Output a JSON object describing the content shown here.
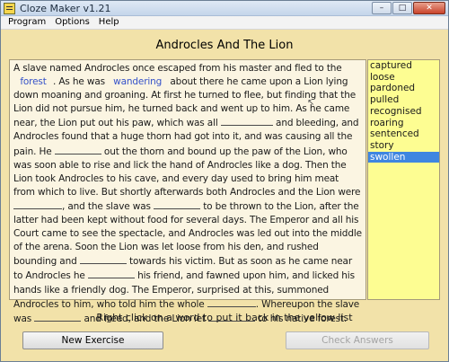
{
  "window": {
    "title": "Cloze Maker v1.21",
    "controls": {
      "minimize": "–",
      "maximize": "□",
      "close": "✕"
    }
  },
  "menu": [
    "Program",
    "Options",
    "Help"
  ],
  "story_title": "Androcles And The Lion",
  "story": {
    "p1": "A slave named Androcles once escaped from his master and fled to the",
    "blank1": "forest",
    "p2": ". As he was",
    "blank2": "wandering",
    "p3": "about there he came upon a Lion lying down moaning and groaning. At first he turned to flee, but finding that the Lion did not pursue him, he turned back and went up to him. As he came near, the Lion put out his paw, which was all",
    "p4": "and bleeding, and Androcles found that a huge thorn had got into it, and was causing all the pain. He",
    "p5": "out the thorn and bound up the paw of the Lion, who was soon able to rise and lick the hand of Androcles like a dog. Then the Lion took Androcles to his cave, and every day used to bring him meat from which to live. But shortly afterwards both Androcles and the Lion were",
    "p6": ", and the slave was",
    "p7": "to be thrown to the Lion, after the latter had been kept without food for several days. The Emperor and all his Court came to see the spectacle, and Androcles was led out into the middle of the arena. Soon the Lion was let loose from his den, and rushed bounding and",
    "p8": "towards his victim. But as soon as he came near to Androcles he",
    "p9": "his friend, and fawned upon him, and licked his hands like a friendly dog. The Emperor, surprised at this, summoned Androcles to him, who told him the whole",
    "p10": ". Whereupon the slave was",
    "p11": "and freed, and the Lion let",
    "p12": "to his native forest."
  },
  "word_list": [
    "captured",
    "loose",
    "pardoned",
    "pulled",
    "recognised",
    "roaring",
    "sentenced",
    "story",
    "swollen"
  ],
  "selected_word": "swollen",
  "instructions": "Right click on a word to put it back in the yellow list",
  "buttons": {
    "new_exercise": "New Exercise",
    "check_answers": "Check Answers"
  },
  "colors": {
    "background": "#f2e2a9",
    "text_panel": "#fbf5e2",
    "word_panel": "#fdfd92",
    "selection": "#3f86e0",
    "filled_word": "#3552c9"
  }
}
